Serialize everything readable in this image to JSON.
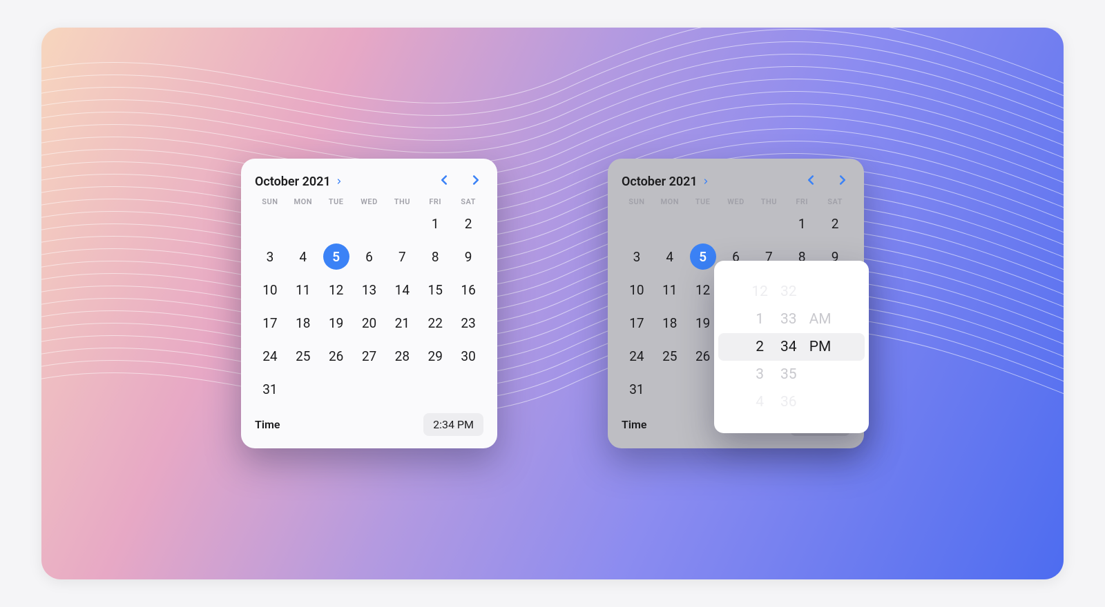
{
  "calendar": {
    "title": "October 2021",
    "weekdays": [
      "SUN",
      "MON",
      "TUE",
      "WED",
      "THU",
      "FRI",
      "SAT"
    ],
    "leadingBlanks": 5,
    "daysInMonth": 31,
    "selectedDay": 5,
    "timeLabel": "Time",
    "timeValue": "2:34 PM"
  },
  "picker": {
    "hours": [
      "12",
      "1",
      "2",
      "3",
      "4"
    ],
    "minutes": [
      "32",
      "33",
      "34",
      "35",
      "36"
    ],
    "period": [
      "",
      "AM",
      "PM",
      "",
      ""
    ]
  }
}
